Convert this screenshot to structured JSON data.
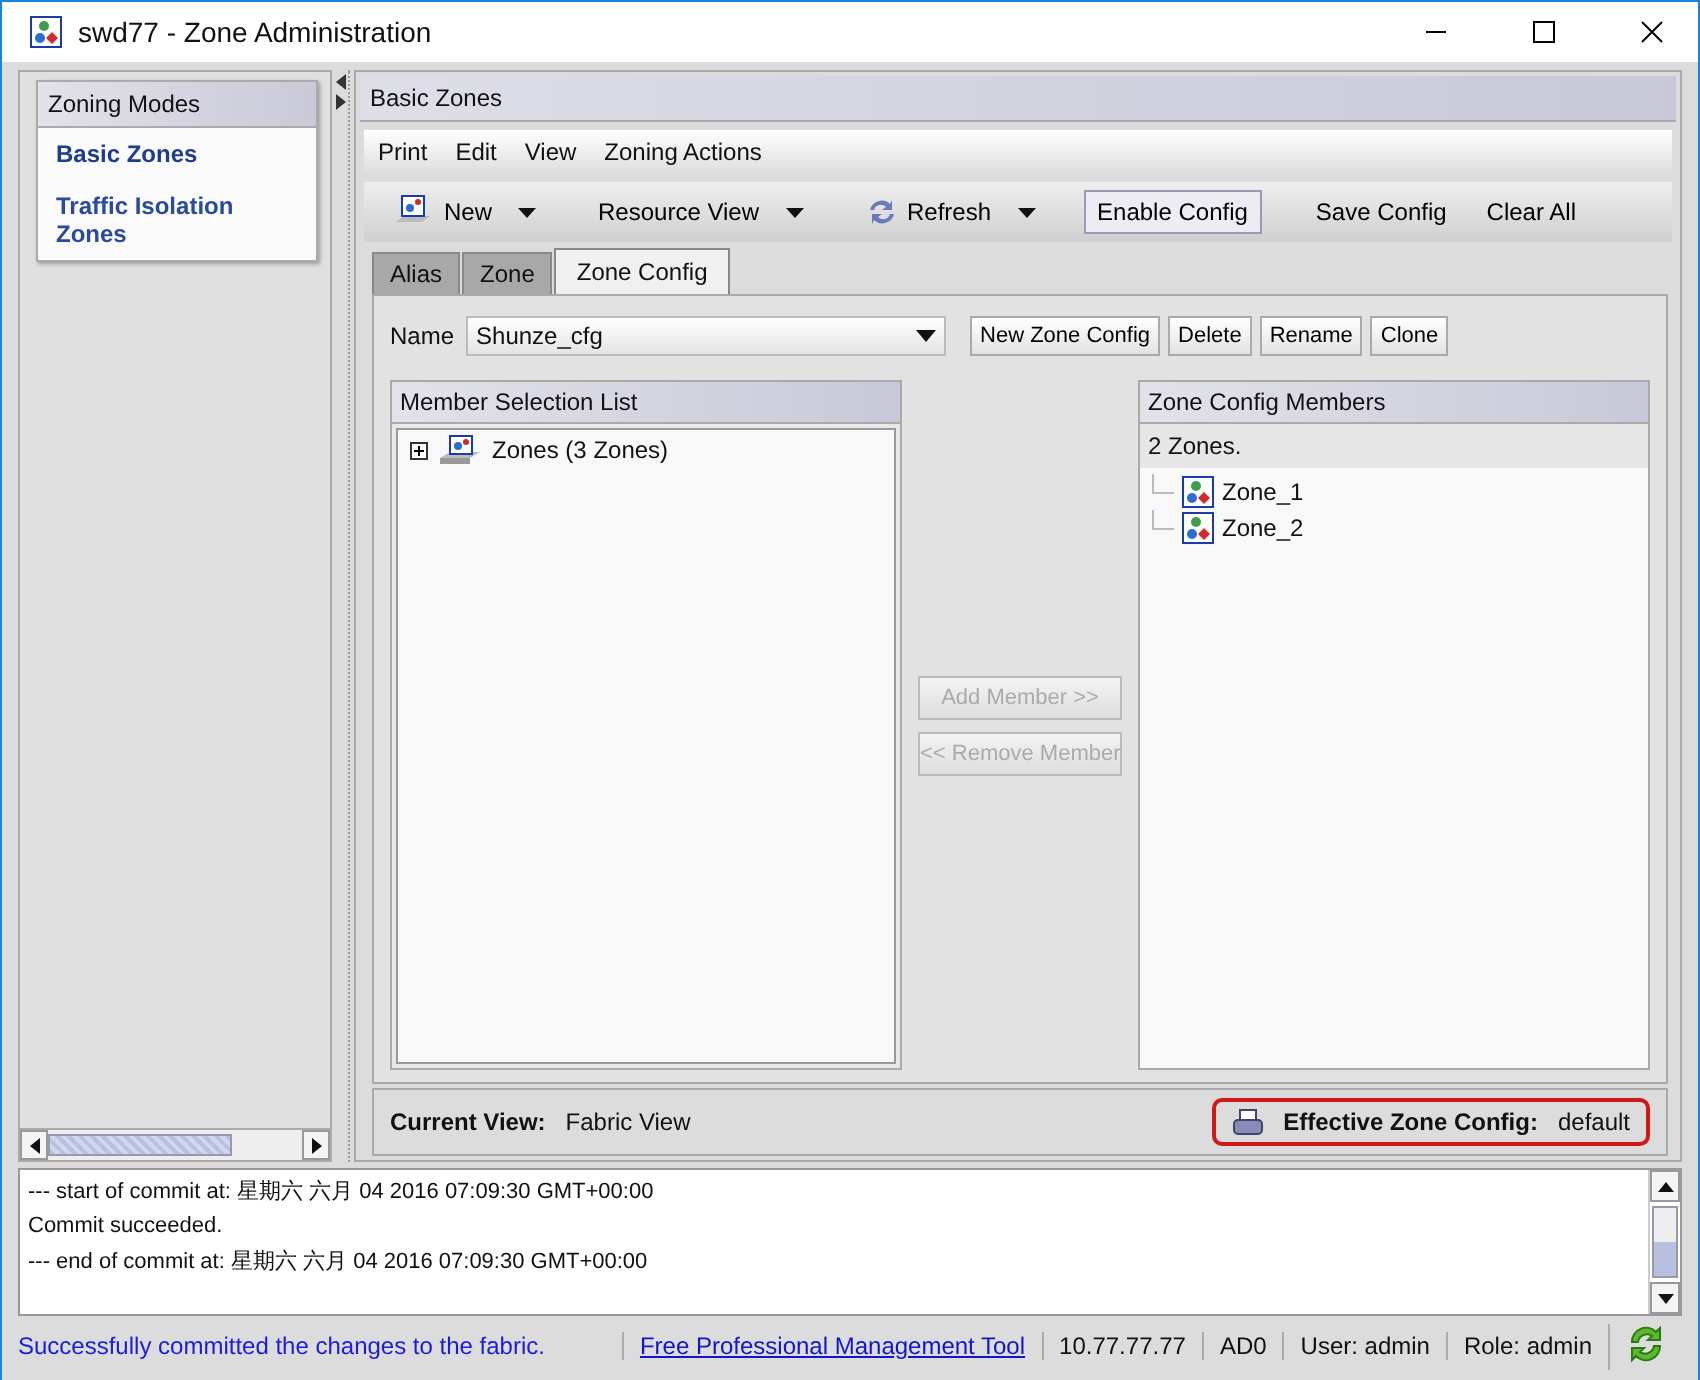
{
  "window": {
    "title": "swd77 - Zone Administration"
  },
  "sidebar": {
    "title": "Zoning Modes",
    "items": [
      {
        "label": "Basic Zones",
        "selected": true
      },
      {
        "label": "Traffic Isolation Zones",
        "selected": false
      }
    ]
  },
  "panel": {
    "title": "Basic Zones"
  },
  "menu": [
    "Print",
    "Edit",
    "View",
    "Zoning Actions"
  ],
  "toolbar": [
    {
      "label": "New",
      "kind": "icon-dropdown"
    },
    {
      "label": "Resource View",
      "kind": "dropdown"
    },
    {
      "label": "Refresh",
      "kind": "icon-dropdown"
    },
    {
      "label": "Enable Config",
      "kind": "framed"
    },
    {
      "label": "Save Config",
      "kind": "plain"
    },
    {
      "label": "Clear All",
      "kind": "plain"
    }
  ],
  "tabs": [
    {
      "label": "Alias",
      "selected": false
    },
    {
      "label": "Zone",
      "selected": false
    },
    {
      "label": "Zone Config",
      "selected": true
    }
  ],
  "name_field": {
    "label": "Name",
    "value": "Shunze_cfg"
  },
  "config_buttons": [
    "New Zone Config",
    "Delete",
    "Rename",
    "Clone"
  ],
  "member_list": {
    "title": "Member Selection List",
    "items": [
      {
        "label": "Zones (3 Zones)",
        "expanded": false
      }
    ]
  },
  "move_buttons": [
    {
      "label": "Add Member >>",
      "disabled": true
    },
    {
      "label": "<< Remove Member",
      "disabled": true
    }
  ],
  "config_members": {
    "title": "Zone Config Members",
    "summary": "2 Zones.",
    "items": [
      "Zone_1",
      "Zone_2"
    ]
  },
  "view_bar": {
    "label": "Current View:",
    "value": "Fabric View",
    "effective_label": "Effective Zone Config:",
    "effective_value": "default",
    "highlighted": true
  },
  "log": [
    "--- start of commit at: 星期六 六月 04 2016 07:09:30 GMT+00:00",
    "Commit succeeded.",
    "--- end of commit at: 星期六 六月 04 2016 07:09:30 GMT+00:00"
  ],
  "status_bar": {
    "message": "Successfully committed the changes to the fabric.",
    "link": "Free Professional Management Tool",
    "fields": [
      "10.77.77.77",
      "AD0",
      "User: admin",
      "Role: admin"
    ]
  }
}
